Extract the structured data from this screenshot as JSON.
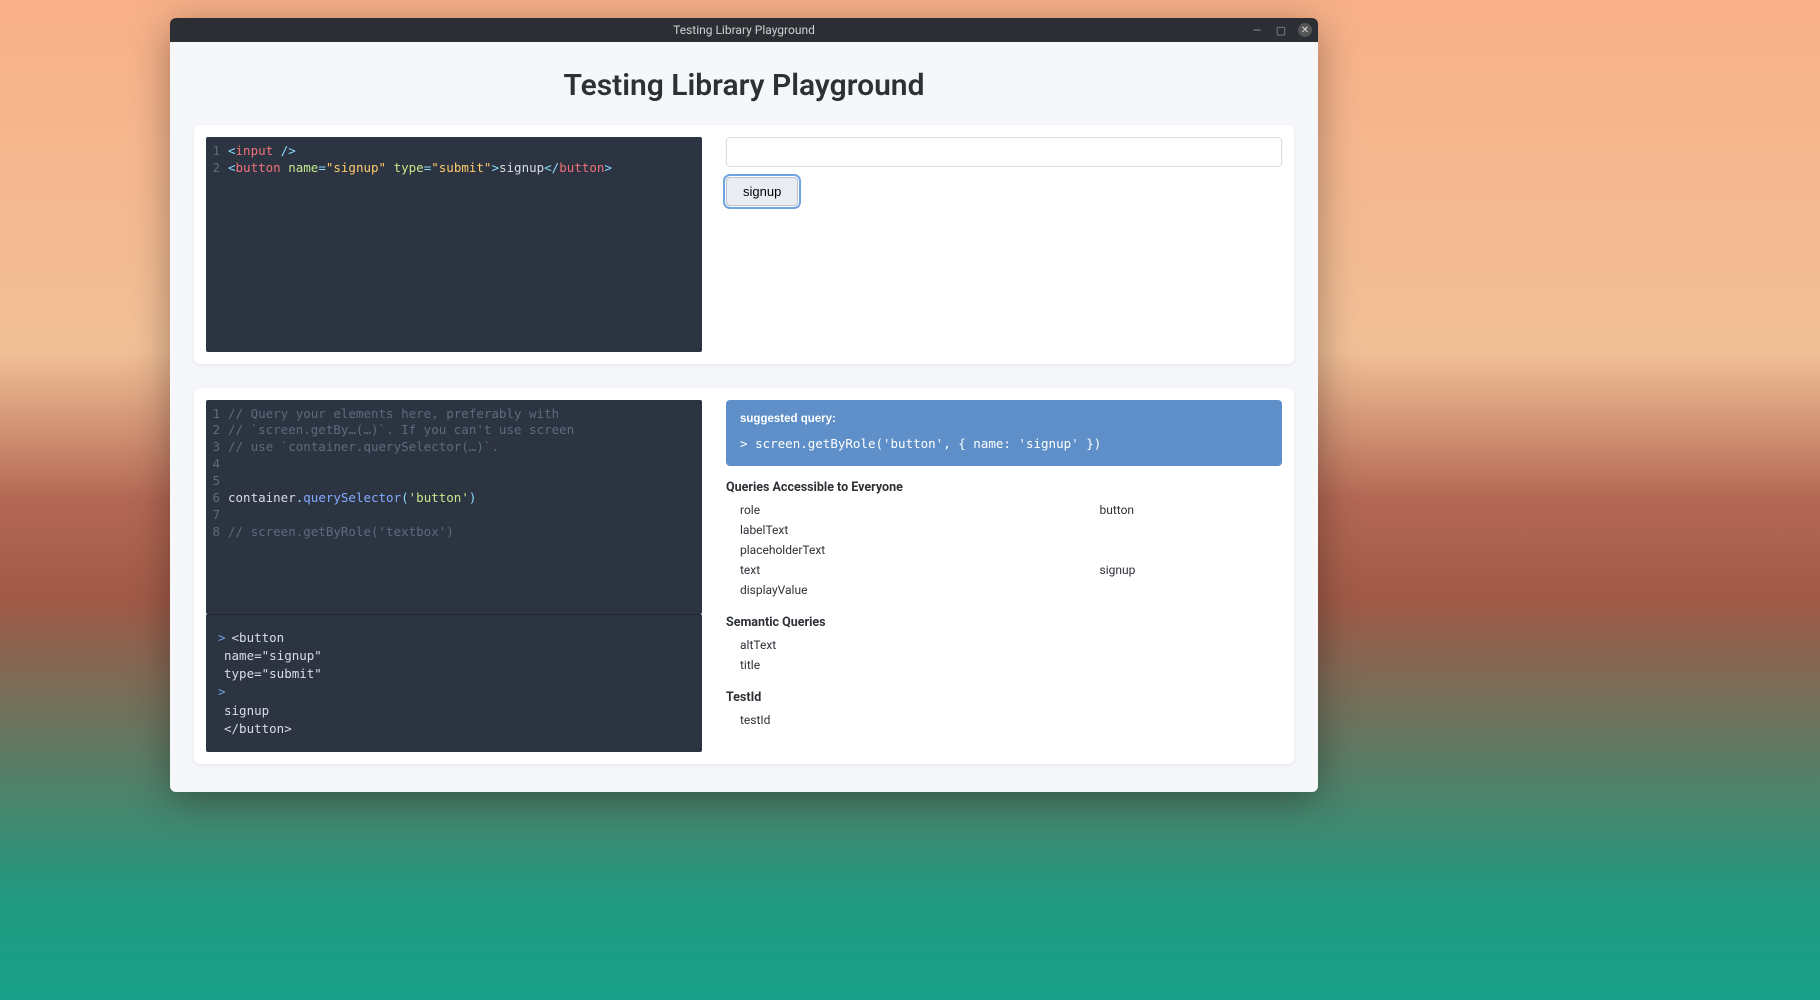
{
  "window": {
    "title": "Testing Library Playground"
  },
  "header": {
    "title": "Testing Library Playground"
  },
  "editor_top": {
    "lines": [
      {
        "ln": "1",
        "tokens": [
          {
            "c": "tok-op",
            "t": "<"
          },
          {
            "c": "tok-tag",
            "t": "input"
          },
          {
            "c": "",
            "t": " "
          },
          {
            "c": "tok-op",
            "t": "/>"
          }
        ]
      },
      {
        "ln": "2",
        "tokens": [
          {
            "c": "tok-op",
            "t": "<"
          },
          {
            "c": "tok-tag",
            "t": "button"
          },
          {
            "c": "",
            "t": " "
          },
          {
            "c": "tok-attr",
            "t": "name"
          },
          {
            "c": "tok-eq",
            "t": "="
          },
          {
            "c": "tok-name",
            "t": "\"signup\""
          },
          {
            "c": "",
            "t": " "
          },
          {
            "c": "tok-attr",
            "t": "type"
          },
          {
            "c": "tok-eq",
            "t": "="
          },
          {
            "c": "tok-name",
            "t": "\"submit\""
          },
          {
            "c": "tok-op",
            "t": ">"
          },
          {
            "c": "tok-ident",
            "t": "signup"
          },
          {
            "c": "tok-op",
            "t": "</"
          },
          {
            "c": "tok-tag",
            "t": "button"
          },
          {
            "c": "tok-op",
            "t": ">"
          }
        ]
      }
    ]
  },
  "preview": {
    "button_label": "signup",
    "input_value": ""
  },
  "editor_bottom": {
    "lines": [
      {
        "ln": "1",
        "tokens": [
          {
            "c": "tok-comment",
            "t": "// Query your elements here, preferably with"
          }
        ]
      },
      {
        "ln": "2",
        "tokens": [
          {
            "c": "tok-comment",
            "t": "// `screen.getBy…(…)`. If you can't use screen"
          }
        ]
      },
      {
        "ln": "3",
        "tokens": [
          {
            "c": "tok-comment",
            "t": "// use `container.querySelector(…)`."
          }
        ]
      },
      {
        "ln": "4",
        "tokens": [
          {
            "c": "",
            "t": ""
          }
        ]
      },
      {
        "ln": "5",
        "tokens": [
          {
            "c": "",
            "t": ""
          }
        ]
      },
      {
        "ln": "6",
        "tokens": [
          {
            "c": "tok-ident",
            "t": "container"
          },
          {
            "c": "tok-punc",
            "t": "."
          },
          {
            "c": "tok-fn",
            "t": "querySelector"
          },
          {
            "c": "tok-punc",
            "t": "("
          },
          {
            "c": "tok-lit",
            "t": "'button'"
          },
          {
            "c": "tok-punc",
            "t": ")"
          }
        ]
      },
      {
        "ln": "7",
        "tokens": [
          {
            "c": "",
            "t": ""
          }
        ]
      },
      {
        "ln": "8",
        "tokens": [
          {
            "c": "tok-comment",
            "t": "// screen.getByRole('textbox')"
          }
        ]
      }
    ],
    "result_lines": [
      {
        "prompt": ">",
        "t": "<button"
      },
      {
        "prompt": "",
        "t": "  name=\"signup\""
      },
      {
        "prompt": "",
        "t": "  type=\"submit\""
      },
      {
        "prompt": ">",
        "t": ""
      },
      {
        "prompt": "",
        "t": "  signup"
      },
      {
        "prompt": "",
        "t": "</button>"
      }
    ]
  },
  "suggested": {
    "label": "suggested query:",
    "prompt": ">",
    "query": "screen.getByRole('button', { name: 'signup' })"
  },
  "query_groups": [
    {
      "title": "Queries Accessible to Everyone",
      "rows": [
        {
          "k": "role",
          "v": "button"
        },
        {
          "k": "labelText",
          "v": ""
        },
        {
          "k": "placeholderText",
          "v": ""
        },
        {
          "k": "text",
          "v": "signup"
        },
        {
          "k": "displayValue",
          "v": ""
        }
      ]
    },
    {
      "title": "Semantic Queries",
      "rows": [
        {
          "k": "altText",
          "v": ""
        },
        {
          "k": "title",
          "v": ""
        }
      ]
    },
    {
      "title": "TestId",
      "rows": [
        {
          "k": "testId",
          "v": ""
        }
      ]
    }
  ]
}
